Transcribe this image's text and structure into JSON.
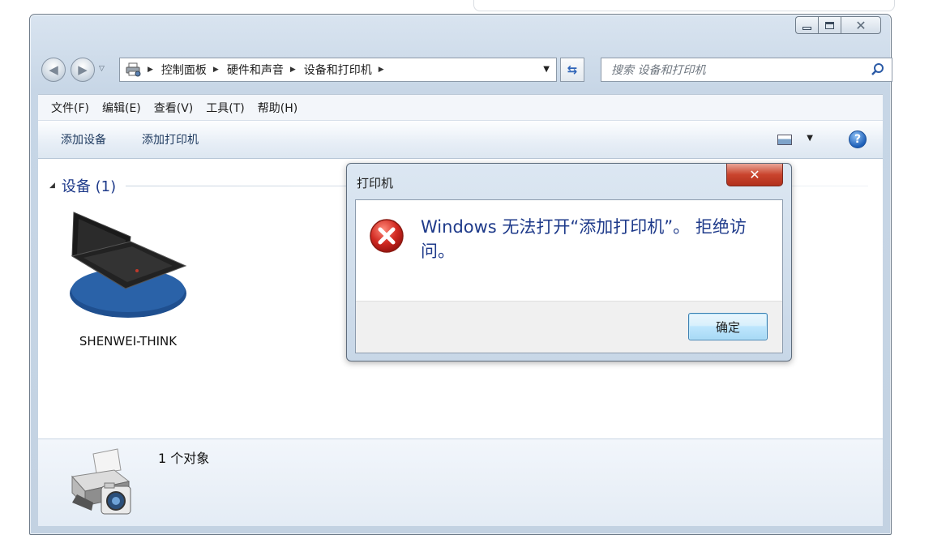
{
  "window": {
    "caption_buttons": {
      "minimize": "",
      "maximize": "",
      "close": "✕"
    }
  },
  "address_bar": {
    "breadcrumbs": [
      "控制面板",
      "硬件和声音",
      "设备和打印机"
    ],
    "search_placeholder": "搜索 设备和打印机"
  },
  "menu": [
    "文件(F)",
    "编辑(E)",
    "查看(V)",
    "工具(T)",
    "帮助(H)"
  ],
  "commands": [
    "添加设备",
    "添加打印机"
  ],
  "devices_group": {
    "title": "设备 (1)",
    "items": [
      {
        "label": "SHENWEI-THINK",
        "icon": "laptop-icon"
      }
    ]
  },
  "details_pane": {
    "count": "1 个对象",
    "icon": "printer-camera-icon"
  },
  "dialog": {
    "title": "打印机",
    "message": "Windows 无法打开“添加打印机”。 拒绝访问。",
    "ok_label": "确定",
    "icon": "error-icon"
  },
  "colors": {
    "link_blue": "#1e3a8a",
    "close_red": "#c9442d",
    "error_red": "#d12a22"
  }
}
